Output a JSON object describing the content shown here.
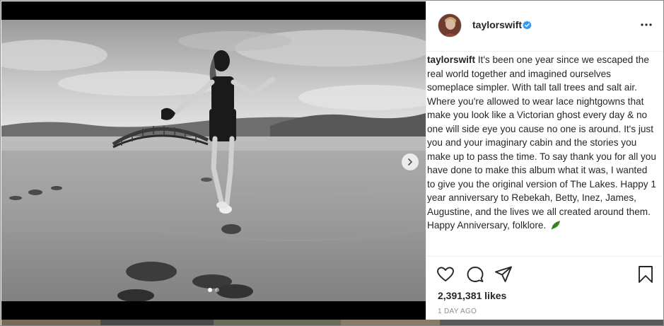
{
  "post": {
    "username": "taylorswift",
    "caption_user": "taylorswift",
    "caption_text": "It's been one year since we escaped the real world together and imagined ourselves someplace simpler. With tall tall trees and salt air. Where you're allowed to wear lace nightgowns that make you look like a Victorian ghost every day & no one will side eye you cause no one is around. It's just you and your imaginary cabin and the stories you make up to pass the time. To say thank you for all you have done to make this album what it was, I wanted to give you the original version of The Lakes. Happy 1 year anniversary to Rebekah, Betty, Inez, James, Augustine, and the lives we all created around them. Happy Anniversary, folklore.",
    "likes": "2,391,381 likes",
    "timestamp": "1 DAY AGO",
    "carousel": {
      "count": 2,
      "active_index": 0
    }
  },
  "icons": {
    "verified": "verified-badge-icon",
    "more": "more-options-icon",
    "like": "heart-icon",
    "comment": "comment-icon",
    "share": "paper-plane-icon",
    "save": "bookmark-icon",
    "next": "chevron-right-icon",
    "leaf": "leaf-emoji-icon"
  },
  "colors": {
    "verified_blue": "#3897f0",
    "text": "#262626",
    "muted": "#8e8e8e",
    "divider": "#efefef"
  }
}
